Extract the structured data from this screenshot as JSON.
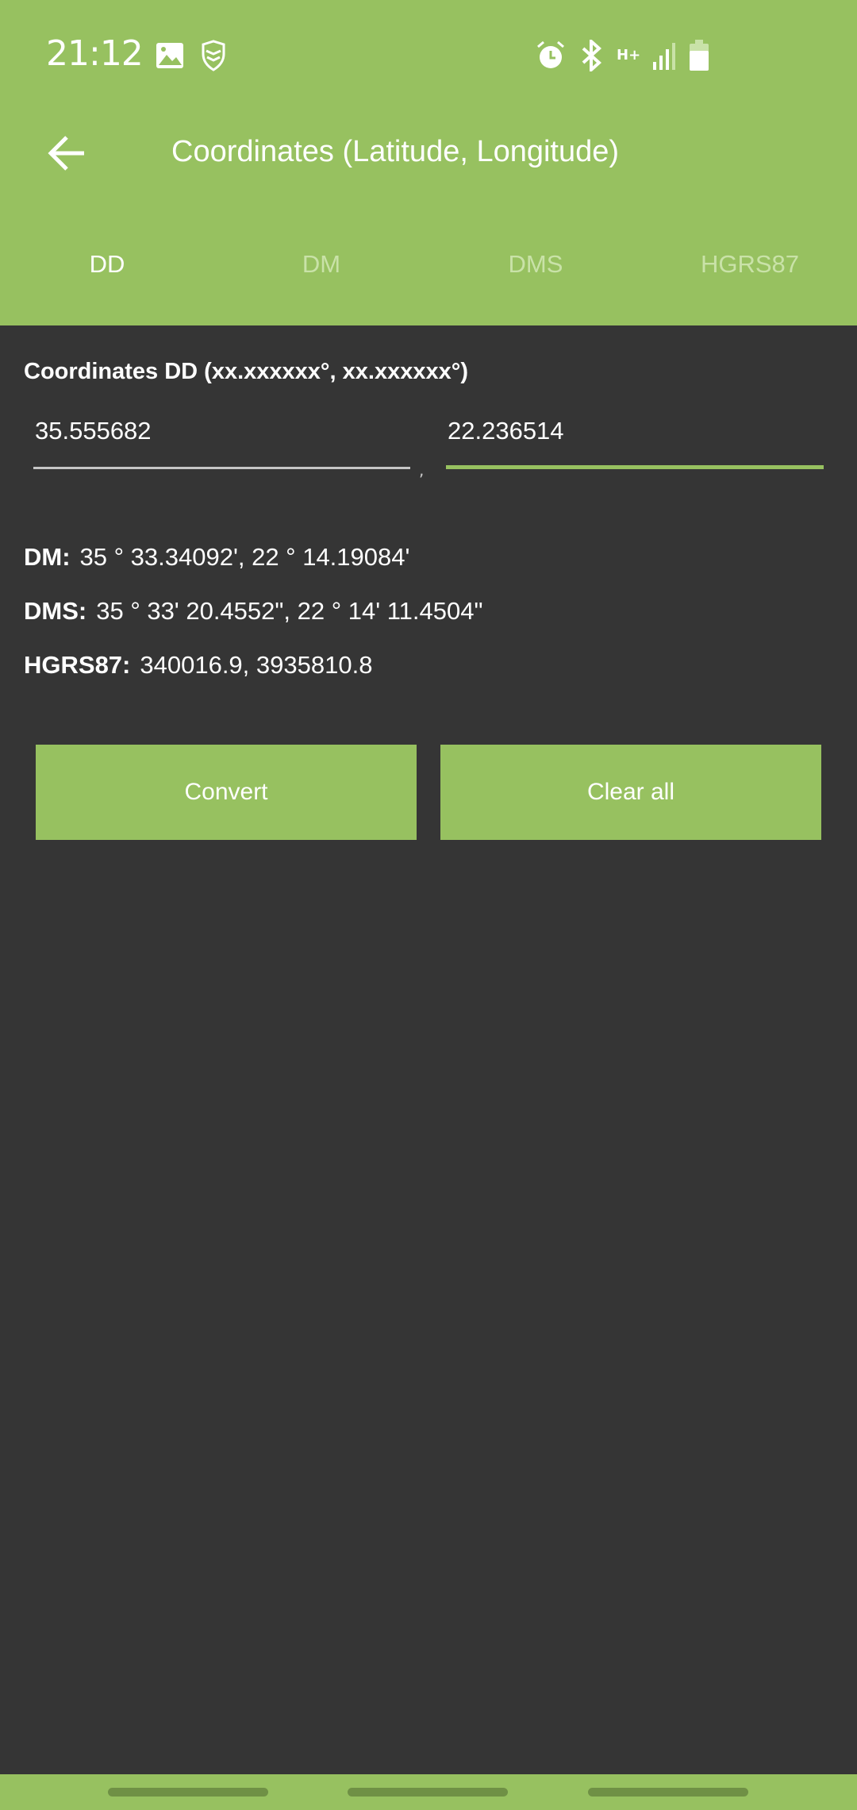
{
  "status_bar": {
    "time": "21:12",
    "icons": [
      "image-icon",
      "shield-icon",
      "alarm-icon",
      "bluetooth-icon",
      "network-hplus-icon",
      "signal-icon",
      "battery-icon"
    ],
    "network_label": "H+"
  },
  "toolbar": {
    "title": "Coordinates (Latitude, Longitude)",
    "back_icon": "arrow-left-icon"
  },
  "tabs": [
    {
      "label": "DD",
      "active": true
    },
    {
      "label": "DM"
    },
    {
      "label": "DMS"
    },
    {
      "label": "HGRS87"
    }
  ],
  "form": {
    "label": "Coordinates DD (xx.xxxxxx°, xx.xxxxxx°)",
    "latitude": "35.555682",
    "longitude": "22.236514",
    "separator": ","
  },
  "results": {
    "dm": {
      "label": "DM:",
      "value": "35 °  33.34092', 22 °  14.19084'"
    },
    "dms": {
      "label": "DMS:",
      "value": "35 °  33' 20.4552\", 22 °  14' 11.4504\""
    },
    "hgrs87": {
      "label": "HGRS87:",
      "value": "340016.9, 3935810.8"
    }
  },
  "buttons": {
    "convert": "Convert",
    "clear": "Clear all"
  },
  "colors": {
    "accent": "#97c160",
    "background": "#353535"
  }
}
